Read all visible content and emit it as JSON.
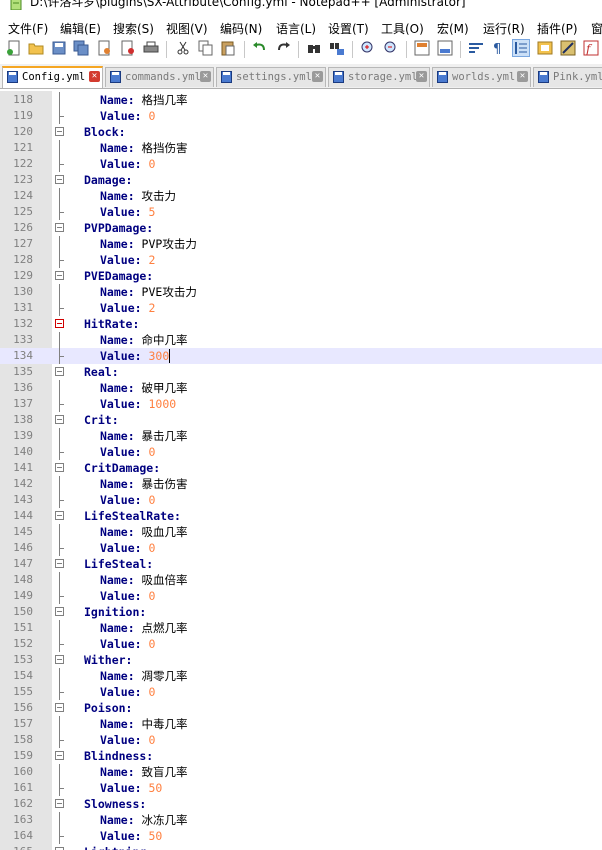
{
  "window": {
    "title": "D:\\许洛斗罗\\plugins\\SX-Attribute\\Config.yml - Notepad++ [Administrator]"
  },
  "menu": [
    "文件(F)",
    "编辑(E)",
    "搜索(S)",
    "视图(V)",
    "编码(N)",
    "语言(L)",
    "设置(T)",
    "工具(O)",
    "宏(M)",
    "运行(R)",
    "插件(P)",
    "窗"
  ],
  "toolbar": {
    "icons": [
      "new-file-icon",
      "open-file-icon",
      "save-icon",
      "save-all-icon",
      "close-icon",
      "close-all-icon",
      "print-icon",
      "cut-icon",
      "copy-icon",
      "paste-icon",
      "undo-icon",
      "redo-icon",
      "find-icon",
      "replace-icon",
      "zoom-in-icon",
      "zoom-out-icon",
      "sync-vertical-icon",
      "sync-horizontal-icon",
      "word-wrap-icon",
      "show-all-chars-icon",
      "indent-guide-icon",
      "doc-map-icon",
      "function-list-icon",
      "macro-record-icon"
    ]
  },
  "tabs": [
    {
      "label": "Config.yml",
      "active": true
    },
    {
      "label": "commands.yml",
      "active": false
    },
    {
      "label": "settings.yml",
      "active": false
    },
    {
      "label": "storage.yml",
      "active": false
    },
    {
      "label": "worlds.yml",
      "active": false
    },
    {
      "label": "Pink.yml",
      "active": false
    }
  ],
  "editor": {
    "current_line": "134",
    "lines": [
      {
        "n": "118",
        "key": "Name:",
        "value": " 格挡几率",
        "type": "text",
        "level": "sub"
      },
      {
        "n": "119",
        "key": "Value:",
        "value": " 0",
        "type": "num",
        "level": "sub"
      },
      {
        "n": "120",
        "key": "Block:",
        "value": "",
        "type": "none",
        "level": "top"
      },
      {
        "n": "121",
        "key": "Name:",
        "value": " 格挡伤害",
        "type": "text",
        "level": "sub"
      },
      {
        "n": "122",
        "key": "Value:",
        "value": " 0",
        "type": "num",
        "level": "sub"
      },
      {
        "n": "123",
        "key": "Damage:",
        "value": "",
        "type": "none",
        "level": "top"
      },
      {
        "n": "124",
        "key": "Name:",
        "value": " 攻击力",
        "type": "text",
        "level": "sub"
      },
      {
        "n": "125",
        "key": "Value:",
        "value": " 5",
        "type": "num",
        "level": "sub"
      },
      {
        "n": "126",
        "key": "PVPDamage:",
        "value": "",
        "type": "none",
        "level": "top"
      },
      {
        "n": "127",
        "key": "Name:",
        "value": " PVP攻击力",
        "type": "text",
        "level": "sub"
      },
      {
        "n": "128",
        "key": "Value:",
        "value": " 2",
        "type": "num",
        "level": "sub"
      },
      {
        "n": "129",
        "key": "PVEDamage:",
        "value": "",
        "type": "none",
        "level": "top"
      },
      {
        "n": "130",
        "key": "Name:",
        "value": " PVE攻击力",
        "type": "text",
        "level": "sub"
      },
      {
        "n": "131",
        "key": "Value:",
        "value": " 2",
        "type": "num",
        "level": "sub"
      },
      {
        "n": "132",
        "key": "HitRate:",
        "value": "",
        "type": "none",
        "level": "top"
      },
      {
        "n": "133",
        "key": "Name:",
        "value": " 命中几率",
        "type": "text",
        "level": "sub"
      },
      {
        "n": "134",
        "key": "Value:",
        "value": " 300",
        "type": "num",
        "level": "sub"
      },
      {
        "n": "135",
        "key": "Real:",
        "value": "",
        "type": "none",
        "level": "top"
      },
      {
        "n": "136",
        "key": "Name:",
        "value": " 破甲几率",
        "type": "text",
        "level": "sub"
      },
      {
        "n": "137",
        "key": "Value:",
        "value": " 1000",
        "type": "num",
        "level": "sub"
      },
      {
        "n": "138",
        "key": "Crit:",
        "value": "",
        "type": "none",
        "level": "top"
      },
      {
        "n": "139",
        "key": "Name:",
        "value": " 暴击几率",
        "type": "text",
        "level": "sub"
      },
      {
        "n": "140",
        "key": "Value:",
        "value": " 0",
        "type": "num",
        "level": "sub"
      },
      {
        "n": "141",
        "key": "CritDamage:",
        "value": "",
        "type": "none",
        "level": "top"
      },
      {
        "n": "142",
        "key": "Name:",
        "value": " 暴击伤害",
        "type": "text",
        "level": "sub"
      },
      {
        "n": "143",
        "key": "Value:",
        "value": " 0",
        "type": "num",
        "level": "sub"
      },
      {
        "n": "144",
        "key": "LifeStealRate:",
        "value": "",
        "type": "none",
        "level": "top"
      },
      {
        "n": "145",
        "key": "Name:",
        "value": " 吸血几率",
        "type": "text",
        "level": "sub"
      },
      {
        "n": "146",
        "key": "Value:",
        "value": " 0",
        "type": "num",
        "level": "sub"
      },
      {
        "n": "147",
        "key": "LifeSteal:",
        "value": "",
        "type": "none",
        "level": "top"
      },
      {
        "n": "148",
        "key": "Name:",
        "value": " 吸血倍率",
        "type": "text",
        "level": "sub"
      },
      {
        "n": "149",
        "key": "Value:",
        "value": " 0",
        "type": "num",
        "level": "sub"
      },
      {
        "n": "150",
        "key": "Ignition:",
        "value": "",
        "type": "none",
        "level": "top"
      },
      {
        "n": "151",
        "key": "Name:",
        "value": " 点燃几率",
        "type": "text",
        "level": "sub"
      },
      {
        "n": "152",
        "key": "Value:",
        "value": " 0",
        "type": "num",
        "level": "sub"
      },
      {
        "n": "153",
        "key": "Wither:",
        "value": "",
        "type": "none",
        "level": "top"
      },
      {
        "n": "154",
        "key": "Name:",
        "value": " 凋零几率",
        "type": "text",
        "level": "sub"
      },
      {
        "n": "155",
        "key": "Value:",
        "value": " 0",
        "type": "num",
        "level": "sub"
      },
      {
        "n": "156",
        "key": "Poison:",
        "value": "",
        "type": "none",
        "level": "top"
      },
      {
        "n": "157",
        "key": "Name:",
        "value": " 中毒几率",
        "type": "text",
        "level": "sub"
      },
      {
        "n": "158",
        "key": "Value:",
        "value": " 0",
        "type": "num",
        "level": "sub"
      },
      {
        "n": "159",
        "key": "Blindness:",
        "value": "",
        "type": "none",
        "level": "top"
      },
      {
        "n": "160",
        "key": "Name:",
        "value": " 致盲几率",
        "type": "text",
        "level": "sub"
      },
      {
        "n": "161",
        "key": "Value:",
        "value": " 50",
        "type": "num",
        "level": "sub"
      },
      {
        "n": "162",
        "key": "Slowness:",
        "value": "",
        "type": "none",
        "level": "top"
      },
      {
        "n": "163",
        "key": "Name:",
        "value": " 冰冻几率",
        "type": "text",
        "level": "sub"
      },
      {
        "n": "164",
        "key": "Value:",
        "value": " 50",
        "type": "num",
        "level": "sub"
      },
      {
        "n": "165",
        "key": "Lightning:",
        "value": "",
        "type": "none",
        "level": "top"
      }
    ]
  }
}
